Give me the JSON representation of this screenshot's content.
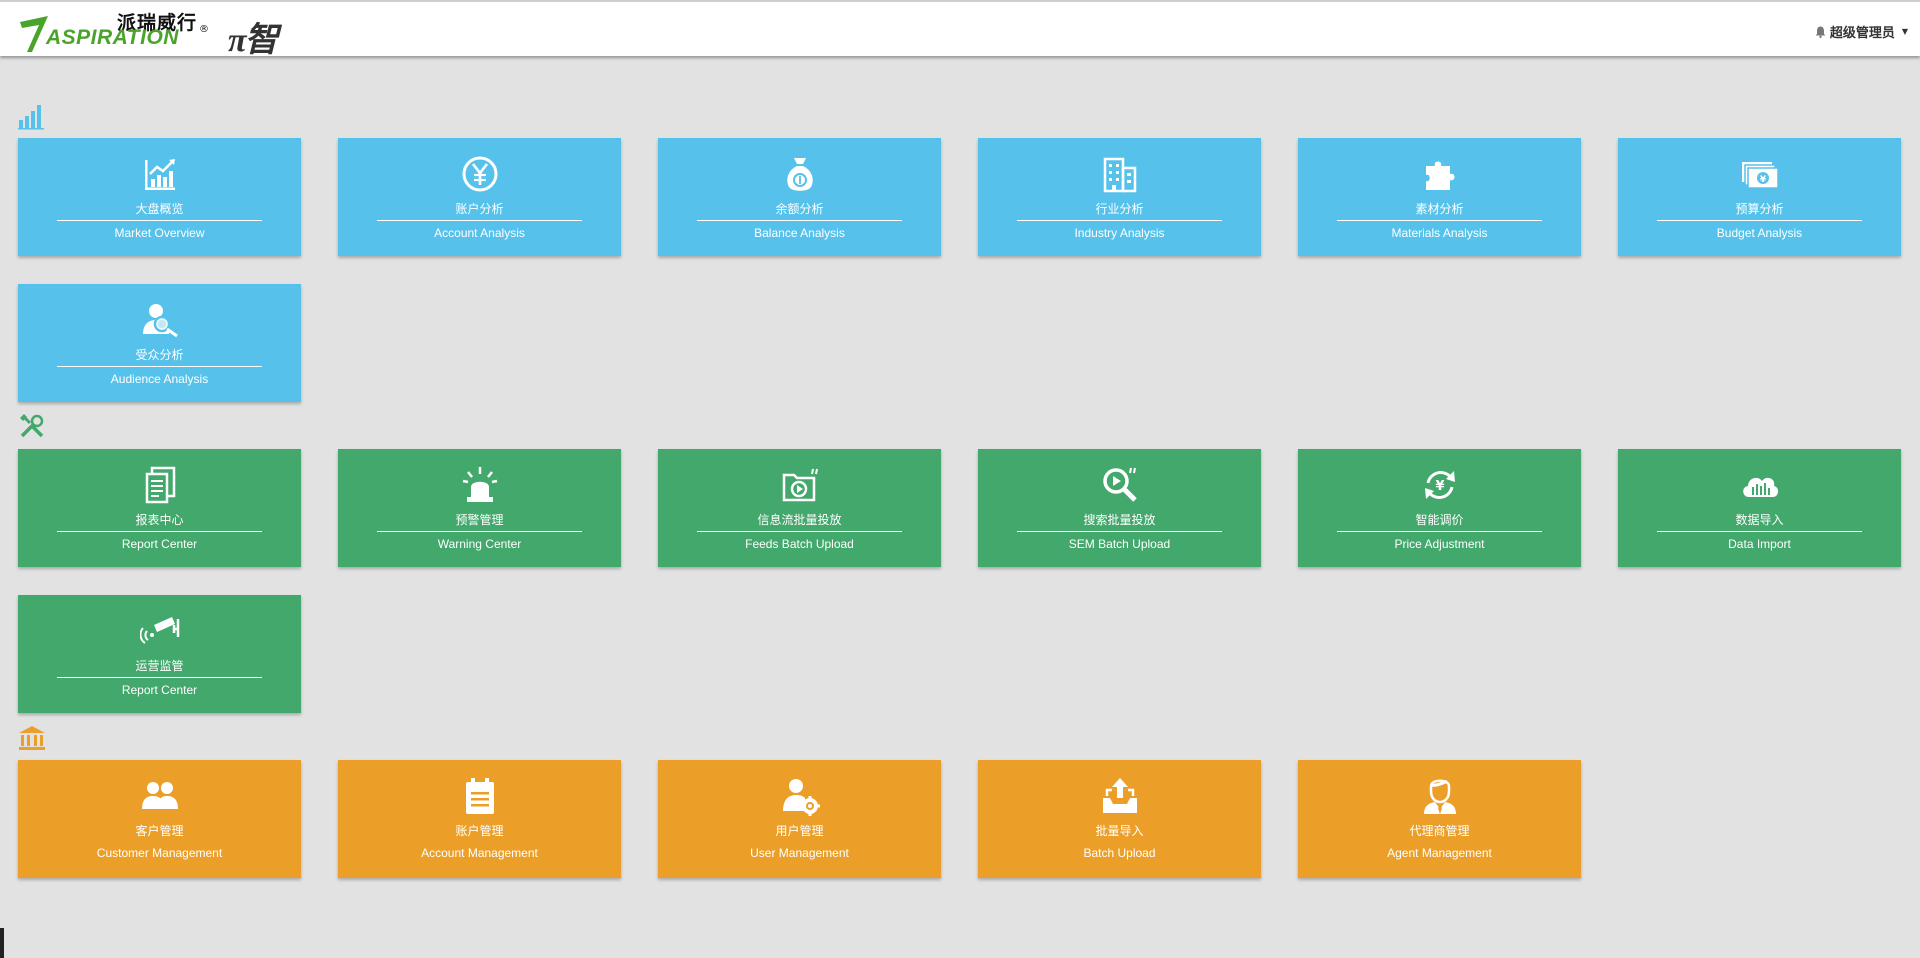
{
  "header": {
    "logo_cn": "派瑞威行",
    "logo_en": "ASPIRATION",
    "logo_reg": "®",
    "product_name": "π智",
    "user_label": "超级管理员"
  },
  "colors": {
    "analysis": "#56c2eb",
    "tools": "#42a86b",
    "management": "#eb9f29"
  },
  "sections": {
    "analysis": {
      "icon": "bar-chart-icon",
      "tiles": [
        {
          "cn": "大盘概览",
          "en": "Market Overview",
          "icon": "trend-chart-icon"
        },
        {
          "cn": "账户分析",
          "en": "Account Analysis",
          "icon": "yen-coin-icon"
        },
        {
          "cn": "余额分析",
          "en": "Balance Analysis",
          "icon": "money-bag-icon"
        },
        {
          "cn": "行业分析",
          "en": "Industry Analysis",
          "icon": "building-icon"
        },
        {
          "cn": "素材分析",
          "en": "Materials Analysis",
          "icon": "puzzle-icon"
        },
        {
          "cn": "预算分析",
          "en": "Budget Analysis",
          "icon": "cash-stack-icon"
        },
        {
          "cn": "受众分析",
          "en": "Audience Analysis",
          "icon": "person-search-icon"
        }
      ]
    },
    "tools": {
      "icon": "tools-icon",
      "tiles": [
        {
          "cn": "报表中心",
          "en": "Report Center",
          "icon": "report-document-icon"
        },
        {
          "cn": "预警管理",
          "en": "Warning Center",
          "icon": "alarm-light-icon"
        },
        {
          "cn": "信息流批量投放",
          "en": "Feeds Batch Upload",
          "icon": "video-folder-icon"
        },
        {
          "cn": "搜索批量投放",
          "en": "SEM Batch Upload",
          "icon": "search-icon"
        },
        {
          "cn": "智能调价",
          "en": "Price Adjustment",
          "icon": "yen-refresh-icon"
        },
        {
          "cn": "数据导入",
          "en": "Data Import",
          "icon": "cloud-data-icon"
        },
        {
          "cn": "运营监管",
          "en": "Report Center",
          "icon": "security-camera-icon"
        }
      ]
    },
    "management": {
      "icon": "bank-icon",
      "tiles": [
        {
          "cn": "客户管理",
          "en": "Customer Management",
          "icon": "users-icon"
        },
        {
          "cn": "账户管理",
          "en": "Account Management",
          "icon": "clipboard-icon"
        },
        {
          "cn": "用户管理",
          "en": "User Management",
          "icon": "user-gear-icon"
        },
        {
          "cn": "批量导入",
          "en": "Batch Upload",
          "icon": "inbox-upload-icon"
        },
        {
          "cn": "代理商管理",
          "en": "Agent Management",
          "icon": "agent-icon"
        }
      ]
    }
  }
}
